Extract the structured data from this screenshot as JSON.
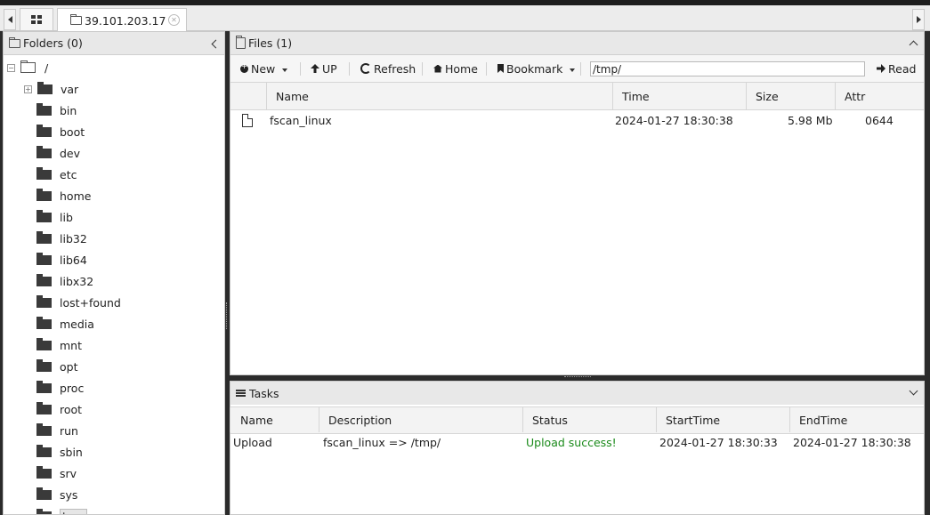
{
  "tabs": {
    "active_label": "39.101.203.17"
  },
  "left_panel": {
    "title": "Folders (0)",
    "root_label": "/",
    "folders": [
      "var",
      "bin",
      "boot",
      "dev",
      "etc",
      "home",
      "lib",
      "lib32",
      "lib64",
      "libx32",
      "lost+found",
      "media",
      "mnt",
      "opt",
      "proc",
      "root",
      "run",
      "sbin",
      "srv",
      "sys",
      "tmp"
    ]
  },
  "files_panel": {
    "title": "Files (1)",
    "toolbar": {
      "new_label": "New",
      "up_label": "UP",
      "refresh_label": "Refresh",
      "home_label": "Home",
      "bookmark_label": "Bookmark",
      "path_value": "/tmp/",
      "read_label": "Read"
    },
    "columns": [
      "Name",
      "Time",
      "Size",
      "Attr"
    ],
    "rows": [
      {
        "name": "fscan_linux",
        "time": "2024-01-27 18:30:38",
        "size": "5.98 Mb",
        "attr": "0644"
      }
    ]
  },
  "tasks_panel": {
    "title": "Tasks",
    "columns": [
      "Name",
      "Description",
      "Status",
      "StartTime",
      "EndTime"
    ],
    "rows": [
      {
        "name": "Upload",
        "description": "fscan_linux => /tmp/",
        "status": "Upload success!",
        "start": "2024-01-27 18:30:33",
        "end": "2024-01-27 18:30:38"
      }
    ],
    "status_color": "#1a8a1a"
  },
  "icons": [
    "grid-icon",
    "folder-icon",
    "close-icon",
    "collapse-left-icon",
    "collapse-up-icon",
    "expand-down-icon",
    "file-icon",
    "tasks-icon"
  ]
}
